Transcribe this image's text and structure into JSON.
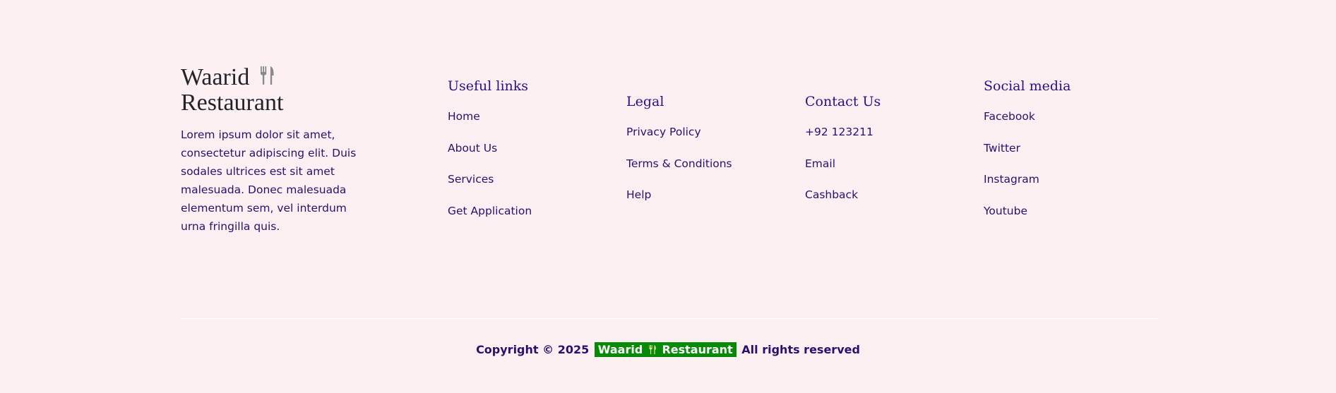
{
  "brand": {
    "name_line1": "Waarid",
    "name_line2": "Restaurant",
    "icon": "fork-knife-icon",
    "description": "Lorem ipsum dolor sit amet, consectetur adipiscing elit. Duis sodales ultrices est sit amet malesuada. Donec malesuada elementum sem, vel interdum urna fringilla quis."
  },
  "useful_links": {
    "title": "Useful links",
    "items": [
      "Home",
      "About Us",
      "Services",
      "Get Application"
    ]
  },
  "legal": {
    "title": "Legal",
    "items": [
      "Privacy Policy",
      "Terms & Conditions",
      "Help"
    ]
  },
  "contact": {
    "title": "Contact Us",
    "items": [
      "+92 123211",
      "Email",
      "Cashback"
    ]
  },
  "social": {
    "title": "Social media",
    "items": [
      "Facebook",
      "Twitter",
      "Instagram",
      "Youtube"
    ]
  },
  "copyright": {
    "prefix": "Copyright © 2025",
    "brand_word1": "Waarid",
    "brand_word2": "Restaurant",
    "suffix": "All rights reserved"
  },
  "colors": {
    "background": "#fdf0f3",
    "link_text": "#2a1070",
    "heading": "#2a0f8a",
    "badge_bg": "#058a05"
  }
}
